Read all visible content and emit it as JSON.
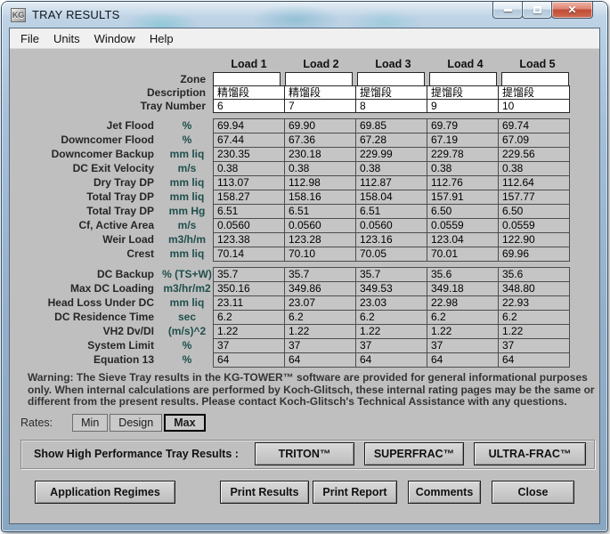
{
  "window": {
    "title": "TRAY RESULTS",
    "icon_text": "KG",
    "controls": {
      "minimize": "minimize",
      "maximize": "maximize",
      "close": "✕"
    }
  },
  "menu": {
    "items": [
      "File",
      "Units",
      "Window",
      "Help"
    ]
  },
  "loads": {
    "headers": [
      "Load 1",
      "Load 2",
      "Load 3",
      "Load 4",
      "Load 5"
    ],
    "zone_label": "Zone",
    "description_label": "Description",
    "tray_number_label": "Tray Number",
    "zone": [
      "",
      "",
      "",
      "",
      ""
    ],
    "description": [
      "精馏段",
      "精馏段",
      "提馏段",
      "提馏段",
      "提馏段"
    ],
    "tray_number": [
      "6",
      "7",
      "8",
      "9",
      "10"
    ]
  },
  "results": {
    "block1": [
      {
        "label": "Jet Flood",
        "unit": "%",
        "values": [
          "69.94",
          "69.90",
          "69.85",
          "69.79",
          "69.74"
        ]
      },
      {
        "label": "Downcomer Flood",
        "unit": "%",
        "values": [
          "67.44",
          "67.36",
          "67.28",
          "67.19",
          "67.09"
        ]
      },
      {
        "label": "Downcomer Backup",
        "unit": "mm liq",
        "values": [
          "230.35",
          "230.18",
          "229.99",
          "229.78",
          "229.56"
        ]
      },
      {
        "label": "DC Exit Velocity",
        "unit": "m/s",
        "values": [
          "0.38",
          "0.38",
          "0.38",
          "0.38",
          "0.38"
        ]
      },
      {
        "label": "Dry Tray DP",
        "unit": "mm liq",
        "values": [
          "113.07",
          "112.98",
          "112.87",
          "112.76",
          "112.64"
        ]
      },
      {
        "label": "Total Tray DP",
        "unit": "mm liq",
        "values": [
          "158.27",
          "158.16",
          "158.04",
          "157.91",
          "157.77"
        ]
      },
      {
        "label": "Total Tray DP",
        "unit": "mm Hg",
        "values": [
          "6.51",
          "6.51",
          "6.51",
          "6.50",
          "6.50"
        ]
      },
      {
        "label": "Cf, Active Area",
        "unit": "m/s",
        "values": [
          "0.0560",
          "0.0560",
          "0.0560",
          "0.0559",
          "0.0559"
        ]
      },
      {
        "label": "Weir Load",
        "unit": "m3/h/m",
        "values": [
          "123.38",
          "123.28",
          "123.16",
          "123.04",
          "122.90"
        ]
      },
      {
        "label": "Crest",
        "unit": "mm liq",
        "values": [
          "70.14",
          "70.10",
          "70.05",
          "70.01",
          "69.96"
        ]
      }
    ],
    "block2": [
      {
        "label": "DC Backup",
        "unit": "% (TS+W)",
        "values": [
          "35.7",
          "35.7",
          "35.7",
          "35.6",
          "35.6"
        ]
      },
      {
        "label": "Max DC Loading",
        "unit": "m3/hr/m2",
        "values": [
          "350.16",
          "349.86",
          "349.53",
          "349.18",
          "348.80"
        ]
      },
      {
        "label": "Head Loss Under DC",
        "unit": "mm liq",
        "values": [
          "23.11",
          "23.07",
          "23.03",
          "22.98",
          "22.93"
        ]
      },
      {
        "label": "DC Residence Time",
        "unit": "sec",
        "values": [
          "6.2",
          "6.2",
          "6.2",
          "6.2",
          "6.2"
        ]
      },
      {
        "label": "VH2 Dv/DI",
        "unit": "(m/s)^2",
        "values": [
          "1.22",
          "1.22",
          "1.22",
          "1.22",
          "1.22"
        ]
      },
      {
        "label": "System Limit",
        "unit": "%",
        "values": [
          "37",
          "37",
          "37",
          "37",
          "37"
        ]
      },
      {
        "label": "Equation 13",
        "unit": "%",
        "values": [
          "64",
          "64",
          "64",
          "64",
          "64"
        ]
      }
    ]
  },
  "warning": "Warning: The Sieve Tray results in the KG-TOWER™ software are provided for general informational purposes only. When internal calculations are performed by Koch-Glitsch, these internal rating pages may be the same or different from the present results. Please contact Koch-Glitsch's Technical Assistance with any questions.",
  "rates": {
    "label": "Rates:",
    "options": [
      "Min",
      "Design",
      "Max"
    ],
    "selected": "Max"
  },
  "high_performance": {
    "label": "Show High Performance Tray Results :",
    "buttons": [
      "TRITON™",
      "SUPERFRAC™",
      "ULTRA-FRAC™"
    ]
  },
  "footer_buttons": [
    "Application Regimes",
    "Print Results",
    "Print Report",
    "Comments",
    "Close"
  ],
  "colors": {
    "client_bg": "#bfbfbf",
    "cell_bg": "#c5c5c5",
    "cell_border": "#4d4d4d",
    "unit_text": "#1f4f4c",
    "close_button": "#c04c36",
    "titlebar": "#a6c0d8"
  }
}
